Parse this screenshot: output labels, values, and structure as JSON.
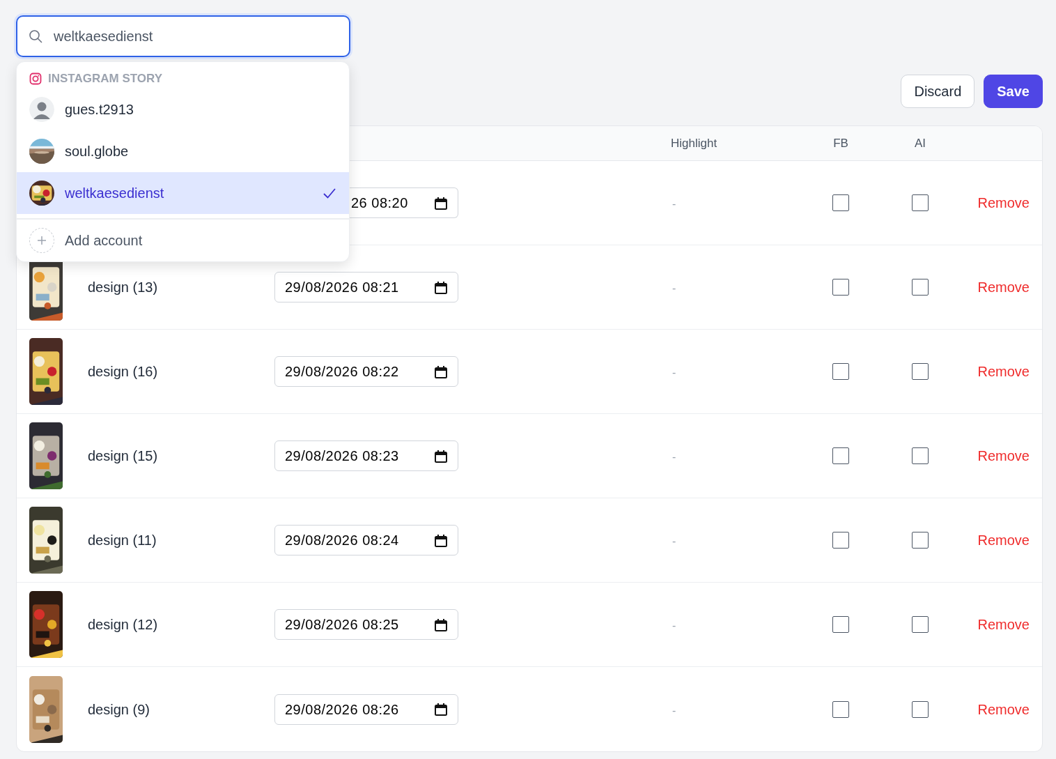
{
  "search": {
    "value": "weltkaesedienst"
  },
  "actions": [
    {
      "label": "Discard",
      "kind": "secondary"
    },
    {
      "label": "Save",
      "kind": "primary"
    }
  ],
  "table": {
    "columns": [
      "Highlight",
      "FB",
      "AI"
    ],
    "rows": [
      {
        "date": "26 08:20",
        "highlight": "-",
        "fb": false,
        "ai": false,
        "action": "Remove"
      },
      {
        "name": "design (13)",
        "date": "29/08/2026 08:21",
        "highlight": "-",
        "fb": false,
        "ai": false,
        "action": "Remove"
      },
      {
        "name": "design (16)",
        "date": "29/08/2026 08:22",
        "highlight": "-",
        "fb": false,
        "ai": false,
        "action": "Remove"
      },
      {
        "name": "design (15)",
        "date": "29/08/2026 08:23",
        "highlight": "-",
        "fb": false,
        "ai": false,
        "action": "Remove"
      },
      {
        "name": "design (11)",
        "date": "29/08/2026 08:24",
        "highlight": "-",
        "fb": false,
        "ai": false,
        "action": "Remove"
      },
      {
        "name": "design (12)",
        "date": "29/08/2026 08:25",
        "highlight": "-",
        "fb": false,
        "ai": false,
        "action": "Remove"
      },
      {
        "name": "design (9)",
        "date": "29/08/2026 08:26",
        "highlight": "-",
        "fb": false,
        "ai": false,
        "action": "Remove"
      }
    ]
  },
  "dropdown": {
    "section": "INSTAGRAM STORY",
    "accounts": [
      {
        "name": "gues.t2913",
        "kind": "placeholder",
        "selected": false
      },
      {
        "name": "soul.globe",
        "kind": "picture",
        "selected": false
      },
      {
        "name": "weltkaesedienst",
        "kind": "picture",
        "selected": true
      }
    ],
    "add_label": "Add account"
  }
}
